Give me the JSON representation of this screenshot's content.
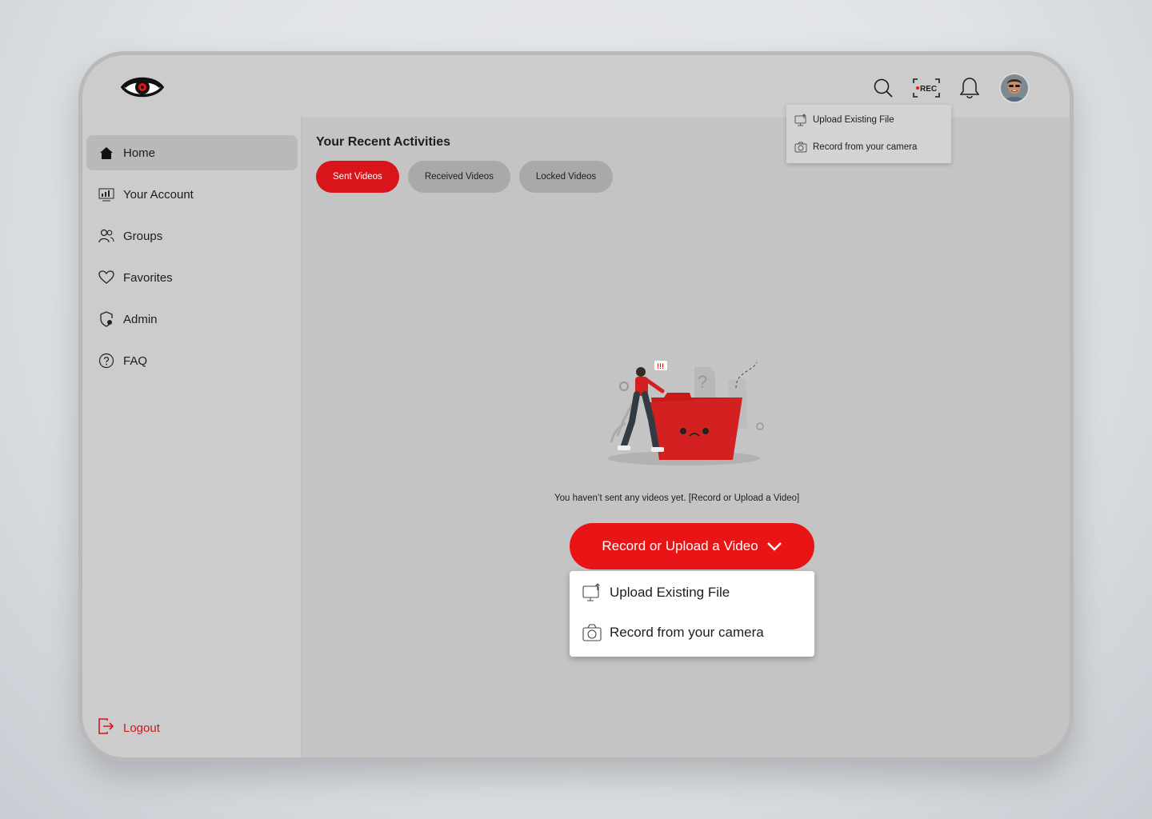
{
  "topbar": {
    "icons": [
      "search-icon",
      "rec-icon",
      "bell-icon"
    ],
    "rec_label": "REC",
    "avatar_icon": "user-avatar"
  },
  "sidebar": {
    "items": [
      {
        "label": "Home",
        "icon": "home-icon",
        "active": true
      },
      {
        "label": "Your Account",
        "icon": "dashboard-icon",
        "active": false
      },
      {
        "label": "Groups",
        "icon": "users-icon",
        "active": false
      },
      {
        "label": "Favorites",
        "icon": "heart-icon",
        "active": false
      },
      {
        "label": "Admin",
        "icon": "shield-icon",
        "active": false
      },
      {
        "label": "FAQ",
        "icon": "question-icon",
        "active": false
      }
    ],
    "logout_label": "Logout"
  },
  "main": {
    "title": "Your Recent Activities",
    "tabs": [
      {
        "label": "Sent Videos",
        "active": true
      },
      {
        "label": "Received Videos",
        "active": false
      },
      {
        "label": "Locked Videos",
        "active": false
      }
    ],
    "empty_message": "You haven’t sent any videos yet. [Record or Upload a Video]",
    "cta_label": "Record or Upload a Video",
    "menu": [
      {
        "label": "Upload Existing File",
        "icon": "upload-icon"
      },
      {
        "label": "Record from your camera",
        "icon": "camera-icon"
      }
    ]
  },
  "header_menu": [
    {
      "label": "Upload Existing File",
      "icon": "upload-icon"
    },
    {
      "label": "Record from your camera",
      "icon": "camera-icon"
    }
  ],
  "colors": {
    "accent": "#e81416",
    "background": "#c4c4c4",
    "sidebar": "#cccccc",
    "tab_inactive": "#a9a9a9"
  }
}
